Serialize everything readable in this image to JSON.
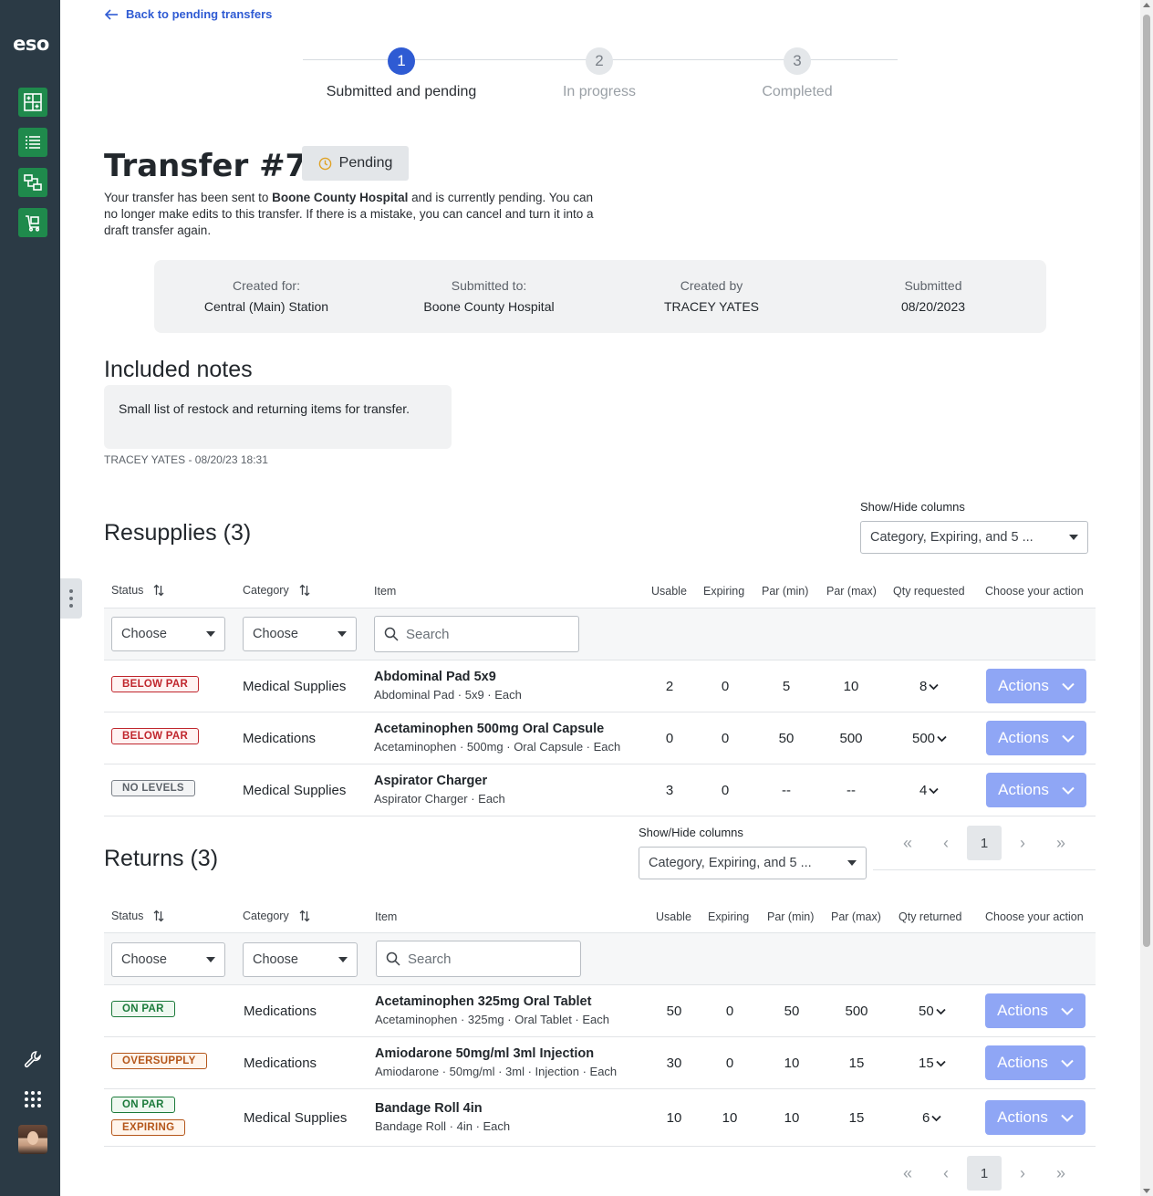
{
  "sidebar": {
    "logo": "eso",
    "nav_icons": [
      "inventory-grid-icon",
      "list-icon",
      "transfer-icon",
      "cart-icon"
    ],
    "bottom_icons": [
      "wrench-icon",
      "apps-grid-icon"
    ]
  },
  "back_link": "Back to pending transfers",
  "stepper": [
    {
      "num": "1",
      "label": "Submitted and pending"
    },
    {
      "num": "2",
      "label": "In progress"
    },
    {
      "num": "3",
      "label": "Completed"
    }
  ],
  "title": "Transfer #71",
  "status_badge": "Pending",
  "description": {
    "pre": "Your transfer has been sent to ",
    "bold": "Boone County Hospital",
    "post": " and is currently pending. You can no longer make edits to this transfer. If there is a mistake, you can cancel and turn it into a draft transfer again."
  },
  "info": [
    {
      "label": "Created for:",
      "value": "Central (Main) Station"
    },
    {
      "label": "Submitted to:",
      "value": "Boone County Hospital"
    },
    {
      "label": "Created by",
      "value": "TRACEY YATES"
    },
    {
      "label": "Submitted",
      "value": "08/20/2023"
    }
  ],
  "notes": {
    "heading": "Included notes",
    "text": "Small list of restock and returning items for transfer.",
    "meta": "TRACEY YATES - 08/20/23 18:31"
  },
  "resupplies": {
    "heading": "Resupplies (3)",
    "showhide_label": "Show/Hide columns",
    "showhide_value": "Category, Expiring, and 5 ...",
    "headers": [
      "Status",
      "Category",
      "Item",
      "Usable",
      "Expiring",
      "Par (min)",
      "Par (max)",
      "Qty requested",
      "Choose your action"
    ],
    "filter_status": "Choose",
    "filter_category": "Choose",
    "search_placeholder": "Search",
    "rows": [
      {
        "badges": [
          {
            "text": "BELOW PAR",
            "tone": "red"
          }
        ],
        "category": "Medical Supplies",
        "name": "Abdominal Pad 5x9",
        "sub": "Abdominal Pad · 5x9 · Each",
        "usable": "2",
        "expiring": "0",
        "par_min": "5",
        "par_max": "10",
        "qty": "8",
        "action": "Actions"
      },
      {
        "badges": [
          {
            "text": "BELOW PAR",
            "tone": "red"
          }
        ],
        "category": "Medications",
        "name": "Acetaminophen 500mg Oral Capsule",
        "sub": "Acetaminophen · 500mg · Oral Capsule · Each",
        "usable": "0",
        "expiring": "0",
        "par_min": "50",
        "par_max": "500",
        "qty": "500",
        "action": "Actions"
      },
      {
        "badges": [
          {
            "text": "NO LEVELS",
            "tone": "gray"
          }
        ],
        "category": "Medical Supplies",
        "name": "Aspirator Charger",
        "sub": "Aspirator Charger · Each",
        "usable": "3",
        "expiring": "0",
        "par_min": "--",
        "par_max": "--",
        "qty": "4",
        "action": "Actions"
      }
    ],
    "page": "1"
  },
  "returns": {
    "heading": "Returns (3)",
    "showhide_label": "Show/Hide columns",
    "showhide_value": "Category, Expiring, and 5 ...",
    "headers": [
      "Status",
      "Category",
      "Item",
      "Usable",
      "Expiring",
      "Par (min)",
      "Par (max)",
      "Qty returned",
      "Choose your action"
    ],
    "filter_status": "Choose",
    "filter_category": "Choose",
    "search_placeholder": "Search",
    "rows": [
      {
        "badges": [
          {
            "text": "ON PAR",
            "tone": "green"
          }
        ],
        "category": "Medications",
        "name": "Acetaminophen 325mg Oral Tablet",
        "sub": "Acetaminophen · 325mg · Oral Tablet · Each",
        "usable": "50",
        "expiring": "0",
        "par_min": "50",
        "par_max": "500",
        "qty": "50",
        "action": "Actions"
      },
      {
        "badges": [
          {
            "text": "OVERSUPPLY",
            "tone": "orange"
          }
        ],
        "category": "Medications",
        "name": "Amiodarone 50mg/ml 3ml Injection",
        "sub": "Amiodarone · 50mg/ml · 3ml · Injection · Each",
        "usable": "30",
        "expiring": "0",
        "par_min": "10",
        "par_max": "15",
        "qty": "15",
        "action": "Actions"
      },
      {
        "badges": [
          {
            "text": "ON PAR",
            "tone": "green"
          },
          {
            "text": "EXPIRING",
            "tone": "orange"
          }
        ],
        "category": "Medical Supplies",
        "name": "Bandage Roll 4in",
        "sub": "Bandage Roll · 4in · Each",
        "usable": "10",
        "expiring": "10",
        "par_min": "10",
        "par_max": "15",
        "qty": "6",
        "action": "Actions"
      }
    ],
    "page": "1"
  },
  "colors": {
    "sidebar": "#2b3a45",
    "nav_green": "#1f8a4c",
    "primary": "#2f5bd3",
    "actions": "#8fa6f5"
  }
}
